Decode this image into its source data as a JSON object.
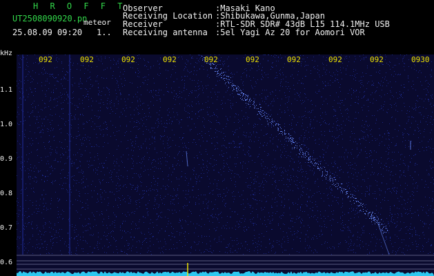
{
  "header": {
    "brand": "H R O F F T",
    "filename": "UT2508090920.pn",
    "type": "meteor",
    "datetime": "25.08.09 09:20",
    "counter": "1.."
  },
  "info": [
    {
      "label": "Observer",
      "value": ":Masaki Kano"
    },
    {
      "label": "Receiving Location",
      "value": ":Shibukawa,Gunma,Japan"
    },
    {
      "label": "Receiver",
      "value": ":RTL-SDR SDR# 43dB L15 114.1MHz USB"
    },
    {
      "label": "Receiving antenna",
      "value": ":5el Yagi Az 20 for Aomori VOR"
    }
  ],
  "axis": {
    "unit": "kHz",
    "ticks": [
      "1.1",
      "1.0",
      "0.9",
      "0.8",
      "0.7",
      "0.6"
    ],
    "time_labels": [
      "092",
      "092",
      "092",
      "092",
      "092",
      "092",
      "092",
      "092",
      "092",
      "0930"
    ]
  },
  "colors": {
    "header_green": "#32d84a",
    "time_yellow": "#f0e400",
    "spectrum_bg": "#0a0a2e",
    "noise_blue": "#2a3fd0",
    "echo": "#6a8cff",
    "baseline": "#2ec8f0"
  }
}
